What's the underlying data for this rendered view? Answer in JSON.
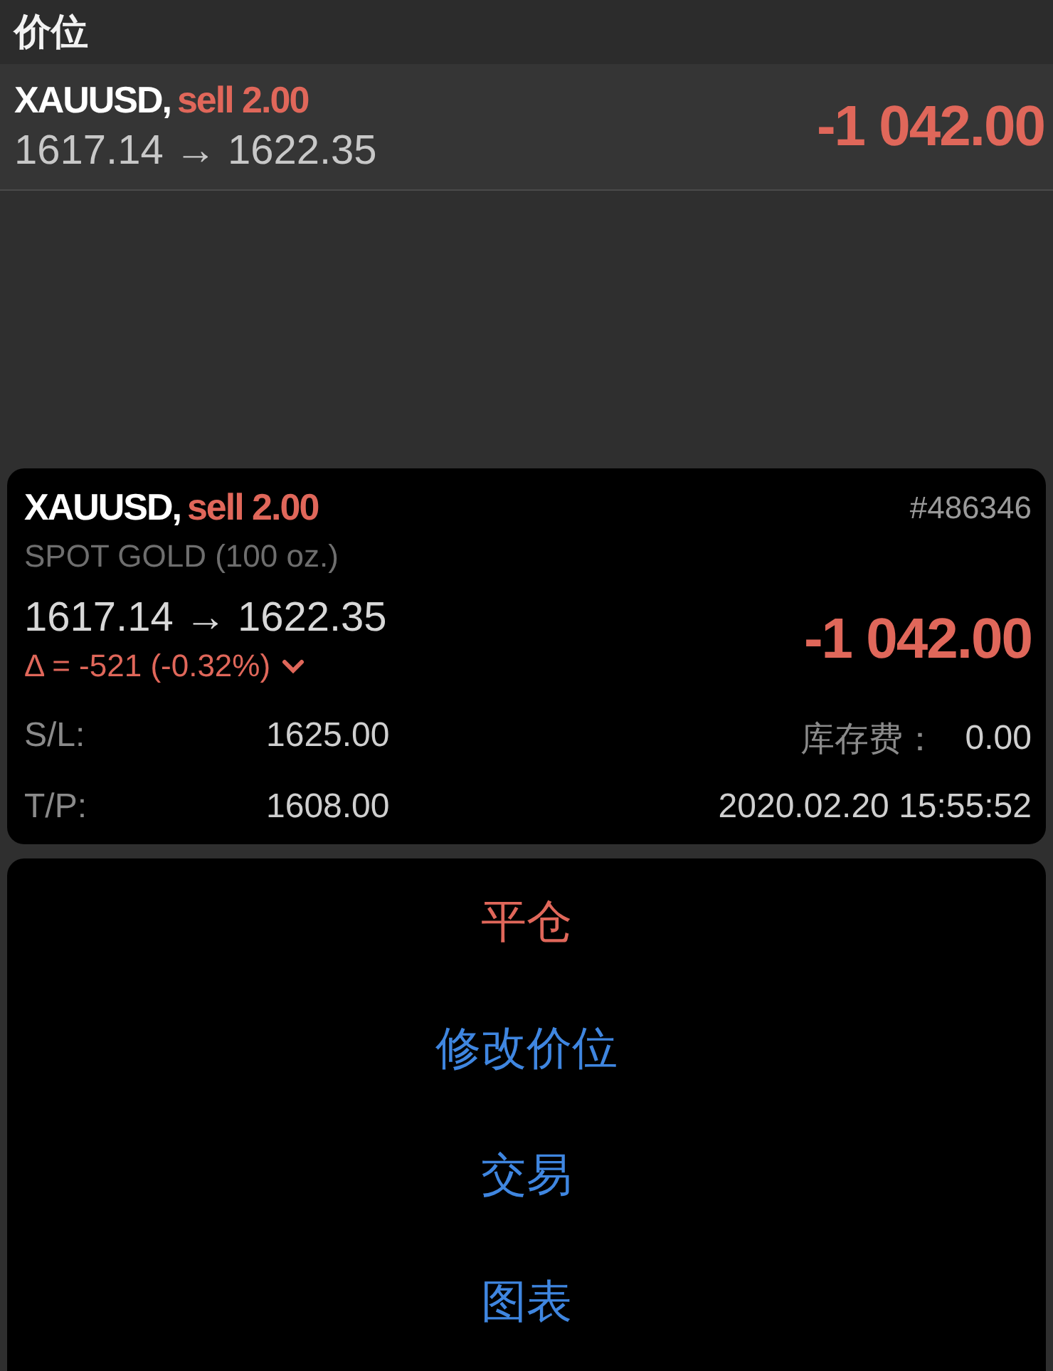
{
  "section_header": {
    "title": "价位"
  },
  "position_row": {
    "symbol": "XAUUSD,",
    "side": "sell 2.00",
    "prices": "1617.14 → 1622.35",
    "profit": "-1 042.00"
  },
  "detail_card": {
    "symbol": "XAUUSD,",
    "side": "sell 2.00",
    "ticket": "#486346",
    "description": "SPOT GOLD (100 oz.)",
    "prices": "1617.14 → 1622.35",
    "delta": "Δ = -521 (-0.32%)",
    "profit": "-1 042.00",
    "fields": [
      {
        "label": "S/L:",
        "value": "1625.00"
      },
      {
        "label": "T/P:",
        "value": "1608.00"
      }
    ],
    "swap": {
      "label": "库存费：",
      "value": "0.00"
    },
    "time": "2020.02.20 15:55:52"
  },
  "actions": [
    {
      "label": "平仓",
      "kind": "destructive"
    },
    {
      "label": "修改价位",
      "kind": "default"
    },
    {
      "label": "交易",
      "kind": "default"
    },
    {
      "label": "图表",
      "kind": "default"
    }
  ]
}
